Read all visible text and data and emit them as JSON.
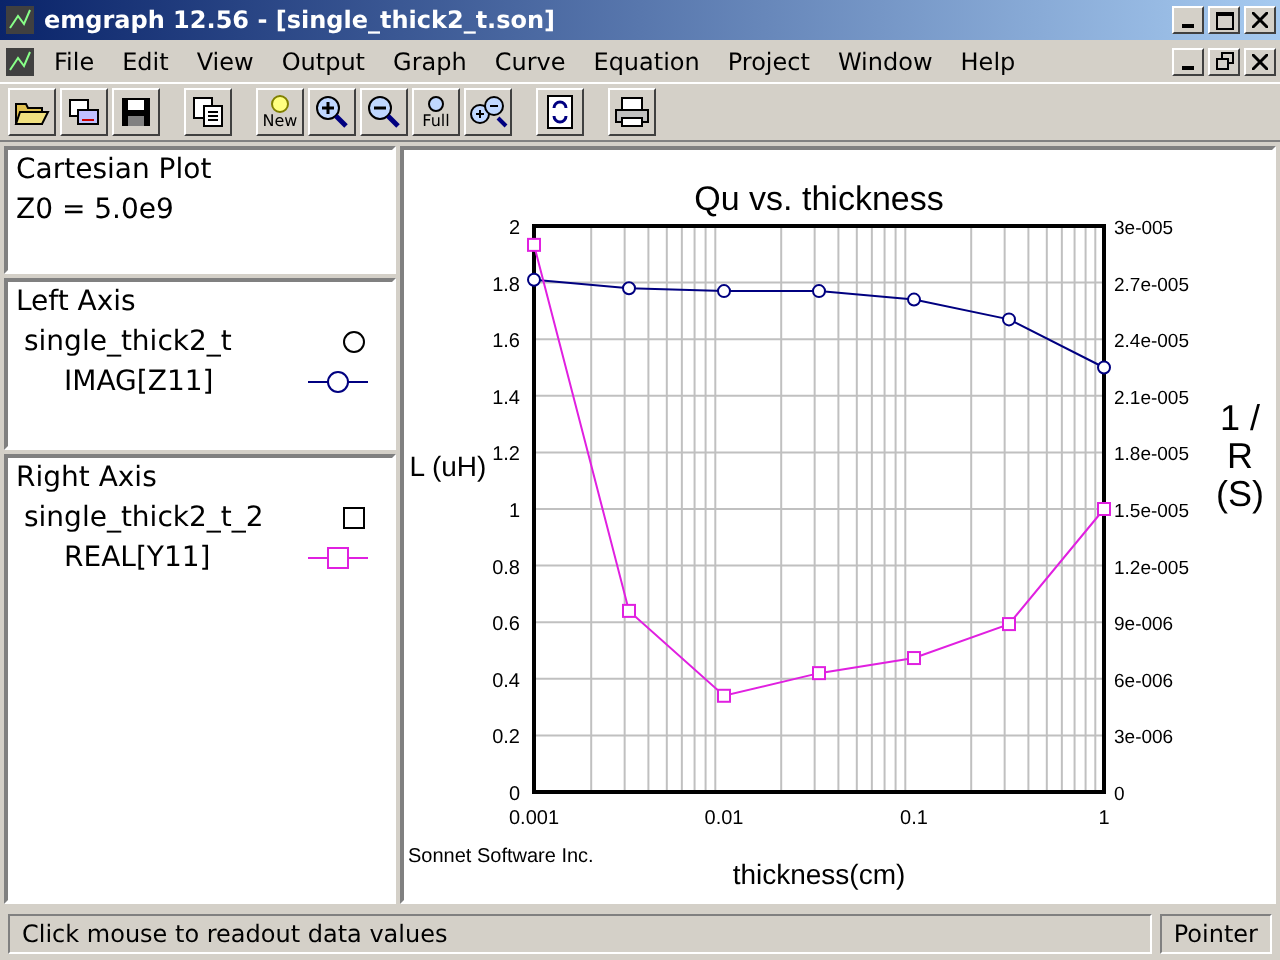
{
  "window": {
    "title": "emgraph 12.56 - [single_thick2_t.son]"
  },
  "menu": [
    {
      "label": "File"
    },
    {
      "label": "Edit"
    },
    {
      "label": "View"
    },
    {
      "label": "Output"
    },
    {
      "label": "Graph"
    },
    {
      "label": "Curve"
    },
    {
      "label": "Equation"
    },
    {
      "label": "Project"
    },
    {
      "label": "Window"
    },
    {
      "label": "Help"
    }
  ],
  "toolbar": [
    {
      "kind": "open"
    },
    {
      "kind": "folders"
    },
    {
      "kind": "save"
    },
    {
      "kind": "gap"
    },
    {
      "kind": "copy"
    },
    {
      "kind": "gap"
    },
    {
      "kind": "new",
      "label": "New"
    },
    {
      "kind": "zoom-in"
    },
    {
      "kind": "zoom-out"
    },
    {
      "kind": "full",
      "label": "Full"
    },
    {
      "kind": "zoom-both"
    },
    {
      "kind": "gap"
    },
    {
      "kind": "refresh"
    },
    {
      "kind": "gap"
    },
    {
      "kind": "print"
    }
  ],
  "sidebar": {
    "plot": {
      "title": "Cartesian Plot",
      "z0": "Z0 = 5.0e9"
    },
    "axes": [
      {
        "title": "Left Axis",
        "file": "single_thick2_t",
        "curve": "IMAG[Z11]",
        "kind": "circle",
        "color": "#000080"
      },
      {
        "title": "Right Axis",
        "file": "single_thick2_t_2",
        "curve": "REAL[Y11]",
        "kind": "square",
        "color": "#e020e0"
      }
    ]
  },
  "chart": {
    "credit": "Sonnet Software Inc.",
    "chart_data": {
      "type": "line",
      "title": "Qu vs. thickness",
      "xlabel": "thickness(cm)",
      "ylabel": "L (uH)",
      "y2label": "1 / R (S)",
      "grid": true,
      "categories": [
        "0.001",
        null,
        "0.01",
        null,
        "0.1",
        null,
        "1"
      ],
      "series": [
        {
          "color": "#000080",
          "marker": "circle",
          "values": [
            1.81,
            1.78,
            1.77,
            1.77,
            1.74,
            1.67,
            1.5
          ]
        },
        {
          "color": "#e020e0",
          "marker": "square",
          "axis": "y2",
          "values": [
            2.9e-05,
            9.6e-06,
            5.1e-06,
            6.3e-06,
            7.1e-06,
            8.9e-06,
            1.5e-05
          ]
        }
      ],
      "ylim": [
        0,
        2
      ],
      "y2lim": [
        0,
        3e-05
      ],
      "yticks": [
        {
          "value": 0,
          "label": "0"
        },
        {
          "value": 0.2,
          "label": "0.2"
        },
        {
          "value": 0.4,
          "label": "0.4"
        },
        {
          "value": 0.6,
          "label": "0.6"
        },
        {
          "value": 0.8,
          "label": "0.8"
        },
        {
          "value": 1,
          "label": "1"
        },
        {
          "value": 1.2,
          "label": "1.2"
        },
        {
          "value": 1.4,
          "label": "1.4"
        },
        {
          "value": 1.6,
          "label": "1.6"
        },
        {
          "value": 1.8,
          "label": "1.8"
        },
        {
          "value": 2,
          "label": "2"
        }
      ],
      "y2ticks": [
        {
          "value": 0,
          "label": "0"
        },
        {
          "value": 3e-06,
          "label": "3e-006"
        },
        {
          "value": 6e-06,
          "label": "6e-006"
        },
        {
          "value": 9e-06,
          "label": "9e-006"
        },
        {
          "value": 1.2e-05,
          "label": "1.2e-005"
        },
        {
          "value": 1.5e-05,
          "label": "1.5e-005"
        },
        {
          "value": 1.8e-05,
          "label": "1.8e-005"
        },
        {
          "value": 2.1e-05,
          "label": "2.1e-005"
        },
        {
          "value": 2.4e-05,
          "label": "2.4e-005"
        },
        {
          "value": 2.7e-05,
          "label": "2.7e-005"
        },
        {
          "value": 3e-05,
          "label": "3e-005"
        }
      ]
    }
  },
  "status_bar": {
    "message": "Click mouse to readout data values",
    "mode": "Pointer"
  }
}
